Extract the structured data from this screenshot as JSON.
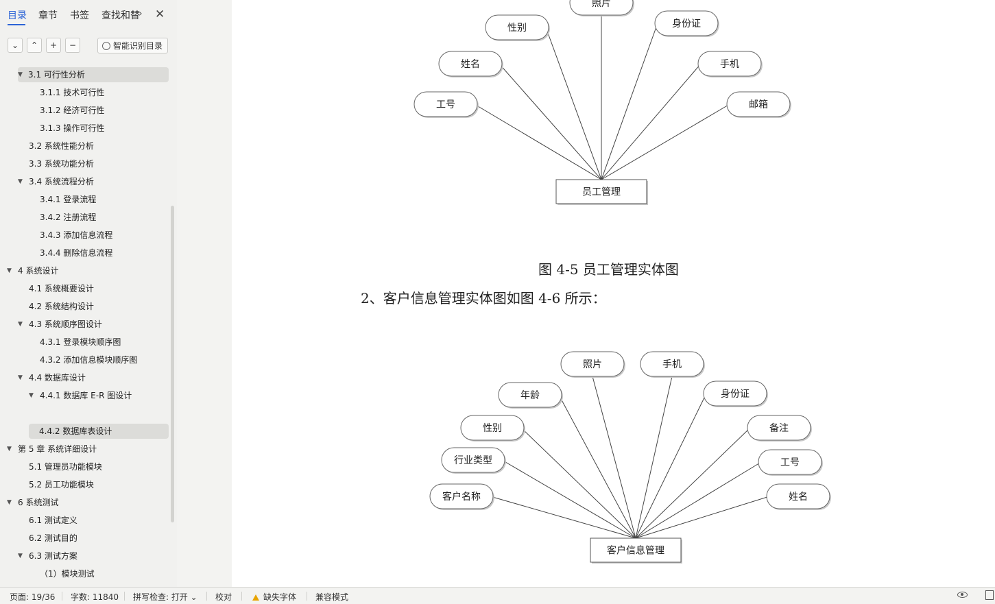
{
  "sidebar": {
    "tabs": [
      "目录",
      "章节",
      "书签",
      "查找和替"
    ],
    "tab_more": "›",
    "close": "✕",
    "toolbar": {
      "collapse": "⌄",
      "expand": "⌃",
      "add": "+",
      "remove": "−",
      "smart": "智能识别目录"
    },
    "toc": [
      {
        "label": "3.1  可行性分析",
        "level": 1,
        "arrow": true,
        "highlight": true
      },
      {
        "label": "3.1.1  技术可行性",
        "level": 2
      },
      {
        "label": "3.1.2 经济可行性",
        "level": 2
      },
      {
        "label": "3.1.3 操作可行性",
        "level": 2
      },
      {
        "label": "3.2  系统性能分析",
        "level": 1
      },
      {
        "label": "3.3  系统功能分析",
        "level": 1
      },
      {
        "label": "3.4 系统流程分析",
        "level": 1,
        "arrow": true
      },
      {
        "label": "3.4.1 登录流程",
        "level": 2
      },
      {
        "label": "3.4.2 注册流程",
        "level": 2
      },
      {
        "label": "3.4.3 添加信息流程",
        "level": 2
      },
      {
        "label": "3.4.4 删除信息流程",
        "level": 2
      },
      {
        "label": "4   系统设计",
        "level": 0,
        "arrow": true
      },
      {
        "label": "4.1 系统概要设计",
        "level": 1
      },
      {
        "label": "4.2 系统结构设计",
        "level": 1
      },
      {
        "label": "4.3 系统顺序图设计",
        "level": 1,
        "arrow": true
      },
      {
        "label": "4.3.1 登录模块顺序图",
        "level": 2
      },
      {
        "label": "4.3.2 添加信息模块顺序图",
        "level": 2
      },
      {
        "label": "4.4 数据库设计",
        "level": 1,
        "arrow": true
      },
      {
        "label": "4.4.1 数据库 E-R 图设计",
        "level": 2,
        "arrow": true
      },
      {
        "label": "",
        "level": 3
      },
      {
        "label": "4.4.2 数据库表设计",
        "level": 2,
        "highlight": true
      },
      {
        "label": "第 5 章  系统详细设计",
        "level": 0,
        "arrow": true
      },
      {
        "label": "5.1 管理员功能模块",
        "level": 1
      },
      {
        "label": "5.2 员工功能模块",
        "level": 1
      },
      {
        "label": "6  系统测试",
        "level": 0,
        "arrow": true
      },
      {
        "label": "6.1  测试定义",
        "level": 1
      },
      {
        "label": "6.2  测试目的",
        "level": 1
      },
      {
        "label": "6.3 测试方案",
        "level": 1,
        "arrow": true
      },
      {
        "label": "（1）模块测试",
        "level": 2
      }
    ]
  },
  "document": {
    "diagram1": {
      "center": "员工管理",
      "attributes": [
        "照片",
        "性别",
        "身份证",
        "姓名",
        "手机",
        "工号",
        "邮箱"
      ]
    },
    "caption1": "图 4-5  员工管理实体图",
    "paragraph": "2、客户信息管理实体图如图 4-6 所示：",
    "diagram2": {
      "center": "客户信息管理",
      "attributes": [
        "照片",
        "手机",
        "年龄",
        "身份证",
        "性别",
        "备注",
        "行业类型",
        "工号",
        "客户名称",
        "姓名"
      ]
    }
  },
  "statusbar": {
    "page": "页面: 19/36",
    "words": "字数: 11840",
    "spell": "拼写检查: 打开 ⌄",
    "proof": "校对",
    "missing_font": "缺失字体",
    "compat": "兼容模式"
  }
}
